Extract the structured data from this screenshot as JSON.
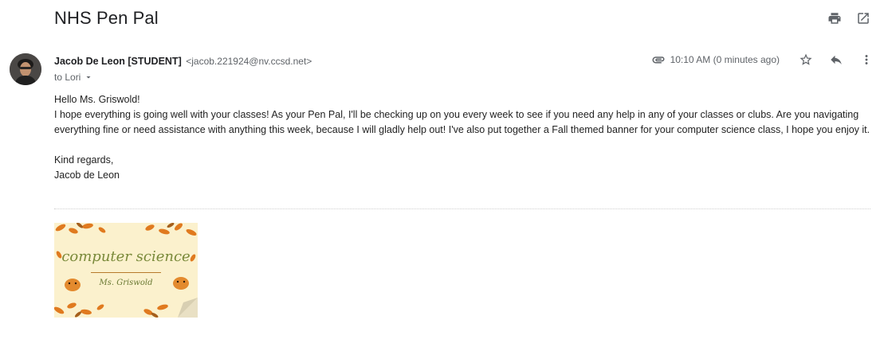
{
  "subject": "NHS Pen Pal",
  "sender": {
    "name": "Jacob De Leon [STUDENT]",
    "email": "<jacob.221924@nv.ccsd.net>",
    "to": "to Lori"
  },
  "meta": {
    "time": "10:10 AM (0 minutes ago)"
  },
  "body": {
    "greeting": "Hello Ms. Griswold!",
    "paragraph": "I hope everything is going well with your classes! As your Pen Pal, I'll be checking up on you every week to see if you need any help in any of your classes or clubs. Are you navigating everything fine or need assistance with anything this week, because I will gladly help out! I've also put together a Fall themed banner for your computer science class, I hope you enjoy it.",
    "signoff": "Kind regards,",
    "signature": "Jacob de Leon"
  },
  "attachment": {
    "title": "computer science",
    "subtitle": "Ms. Griswold"
  },
  "icons": {
    "print": "print-icon",
    "open": "open-in-new-icon",
    "attachment": "paperclip-icon",
    "star": "star-icon",
    "reply": "reply-icon",
    "more": "more-vert-icon",
    "dropdown": "chevron-down-icon"
  },
  "colors": {
    "banner_bg": "#fbf1cd",
    "banner_text": "#7a8a3a",
    "leaf_orange": "#e07a1f"
  }
}
